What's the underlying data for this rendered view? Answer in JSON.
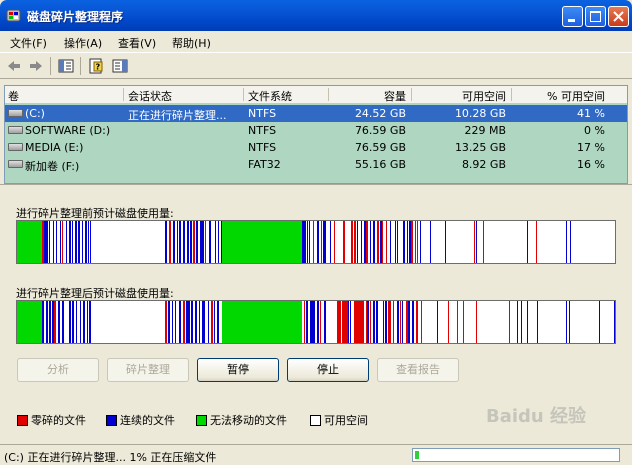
{
  "window": {
    "title": "磁盘碎片整理程序"
  },
  "menu": [
    "文件(F)",
    "操作(A)",
    "查看(V)",
    "帮助(H)"
  ],
  "toolbar": {
    "icons": [
      "back-icon",
      "forward-icon",
      "properties-icon",
      "help-icon",
      "console-icon"
    ]
  },
  "volumes": {
    "columns": [
      "卷",
      "会话状态",
      "文件系统",
      "容量",
      "可用空间",
      "% 可用空间"
    ],
    "rows": [
      {
        "volume": "(C:)",
        "status": "正在进行碎片整理...",
        "fs": "NTFS",
        "capacity": "24.52 GB",
        "free": "10.28 GB",
        "pct": "41 %"
      },
      {
        "volume": "SOFTWARE (D:)",
        "status": "",
        "fs": "NTFS",
        "capacity": "76.59 GB",
        "free": "229 MB",
        "pct": "0 %"
      },
      {
        "volume": "MEDIA (E:)",
        "status": "",
        "fs": "NTFS",
        "capacity": "76.59 GB",
        "free": "13.25 GB",
        "pct": "17 %"
      },
      {
        "volume": "新加卷 (F:)",
        "status": "",
        "fs": "FAT32",
        "capacity": "55.16 GB",
        "free": "8.92 GB",
        "pct": "16 %"
      }
    ]
  },
  "before": {
    "label": "进行碎片整理前预计磁盘使用量:"
  },
  "after": {
    "label": "进行碎片整理后预计磁盘使用量:"
  },
  "buttons": {
    "analyze": "分析",
    "defrag": "碎片整理",
    "pause": "暂停",
    "stop": "停止",
    "report": "查看报告"
  },
  "legend": {
    "fragmented": "零碎的文件",
    "contiguous": "连续的文件",
    "unmovable": "无法移动的文件",
    "free": "可用空间"
  },
  "colors": {
    "fragmented": "#e00000",
    "contiguous": "#0000d0",
    "unmovable": "#00d800",
    "free": "#ffffff",
    "selection": "#316ac5"
  },
  "status": {
    "text": "(C:) 正在进行碎片整理... 1%  正在压缩文件",
    "progress": 0.02
  },
  "watermark": {
    "text": "Baidu 经验"
  }
}
